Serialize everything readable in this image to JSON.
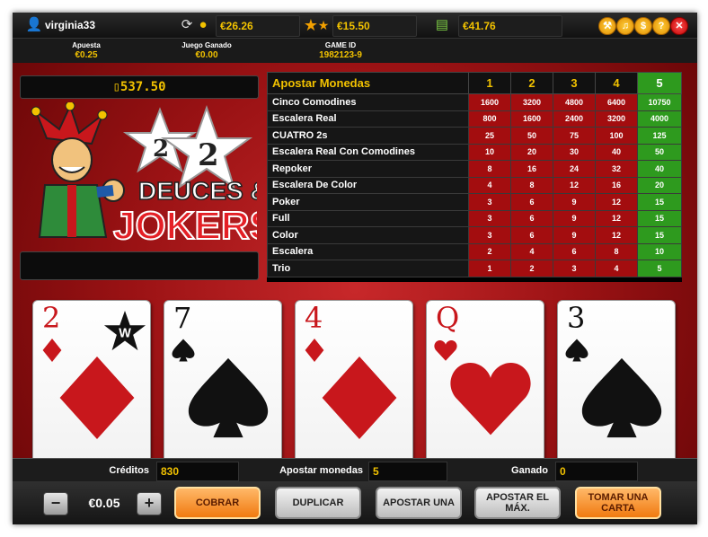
{
  "user": {
    "name": "virginia33",
    "balance_cash": "€26.26",
    "balance_bonus": "€15.50",
    "balance_wallet": "€41.76"
  },
  "info": {
    "bet_label": "Apuesta",
    "bet_value": "€0.25",
    "won_label": "Juego Ganado",
    "won_value": "€0.00",
    "gameid_label": "GAME ID",
    "gameid_value": "1982123-9"
  },
  "window_buttons": [
    "wrench-icon",
    "sound-icon",
    "dollar-icon",
    "help-icon",
    "close-icon"
  ],
  "jackpot": "537.50",
  "logo": {
    "line1": "DEUCES &",
    "line2": "JOKERS",
    "star1": "2",
    "star2": "2"
  },
  "paytable": {
    "header": "Apostar Monedas",
    "columns": [
      "1",
      "2",
      "3",
      "4",
      "5"
    ],
    "selected_column": 5,
    "rows": [
      {
        "name": "Cinco Comodines",
        "values": [
          "1600",
          "3200",
          "4800",
          "6400",
          "10750"
        ]
      },
      {
        "name": "Escalera Real",
        "values": [
          "800",
          "1600",
          "2400",
          "3200",
          "4000"
        ]
      },
      {
        "name": "CUATRO 2s",
        "values": [
          "25",
          "50",
          "75",
          "100",
          "125"
        ]
      },
      {
        "name": "Escalera Real Con Comodines",
        "values": [
          "10",
          "20",
          "30",
          "40",
          "50"
        ]
      },
      {
        "name": "Repoker",
        "values": [
          "8",
          "16",
          "24",
          "32",
          "40"
        ]
      },
      {
        "name": "Escalera De Color",
        "values": [
          "4",
          "8",
          "12",
          "16",
          "20"
        ]
      },
      {
        "name": "Poker",
        "values": [
          "3",
          "6",
          "9",
          "12",
          "15"
        ]
      },
      {
        "name": "Full",
        "values": [
          "3",
          "6",
          "9",
          "12",
          "15"
        ]
      },
      {
        "name": "Color",
        "values": [
          "3",
          "6",
          "9",
          "12",
          "15"
        ]
      },
      {
        "name": "Escalera",
        "values": [
          "2",
          "4",
          "6",
          "8",
          "10"
        ]
      },
      {
        "name": "Trio",
        "values": [
          "1",
          "2",
          "3",
          "4",
          "5"
        ]
      }
    ]
  },
  "cards": [
    {
      "rank": "2",
      "suit": "diamond",
      "color": "red",
      "wild": true,
      "wild_label": "W"
    },
    {
      "rank": "7",
      "suit": "spade",
      "color": "black",
      "wild": false
    },
    {
      "rank": "4",
      "suit": "diamond",
      "color": "red",
      "wild": false
    },
    {
      "rank": "Q",
      "suit": "heart",
      "color": "red",
      "wild": false
    },
    {
      "rank": "3",
      "suit": "spade",
      "color": "black",
      "wild": false
    }
  ],
  "status": {
    "credits_label": "Créditos",
    "credits_value": "830",
    "coins_label": "Apostar monedas",
    "coins_value": "5",
    "won_label": "Ganado",
    "won_value": "0"
  },
  "controls": {
    "minus": "−",
    "plus": "+",
    "coin_value": "€0.05",
    "cobrar": "COBRAR",
    "duplicar": "DUPLICAR",
    "apostar_una": "APOSTAR UNA",
    "apostar_max": "APOSTAR EL MÁX.",
    "tomar_carta": "TOMAR UNA CARTA"
  },
  "colors": {
    "accent": "#f2c200",
    "table_red": "#a30d0f",
    "selected_green": "#2e9a1e",
    "button_orange": "#f07a10"
  }
}
